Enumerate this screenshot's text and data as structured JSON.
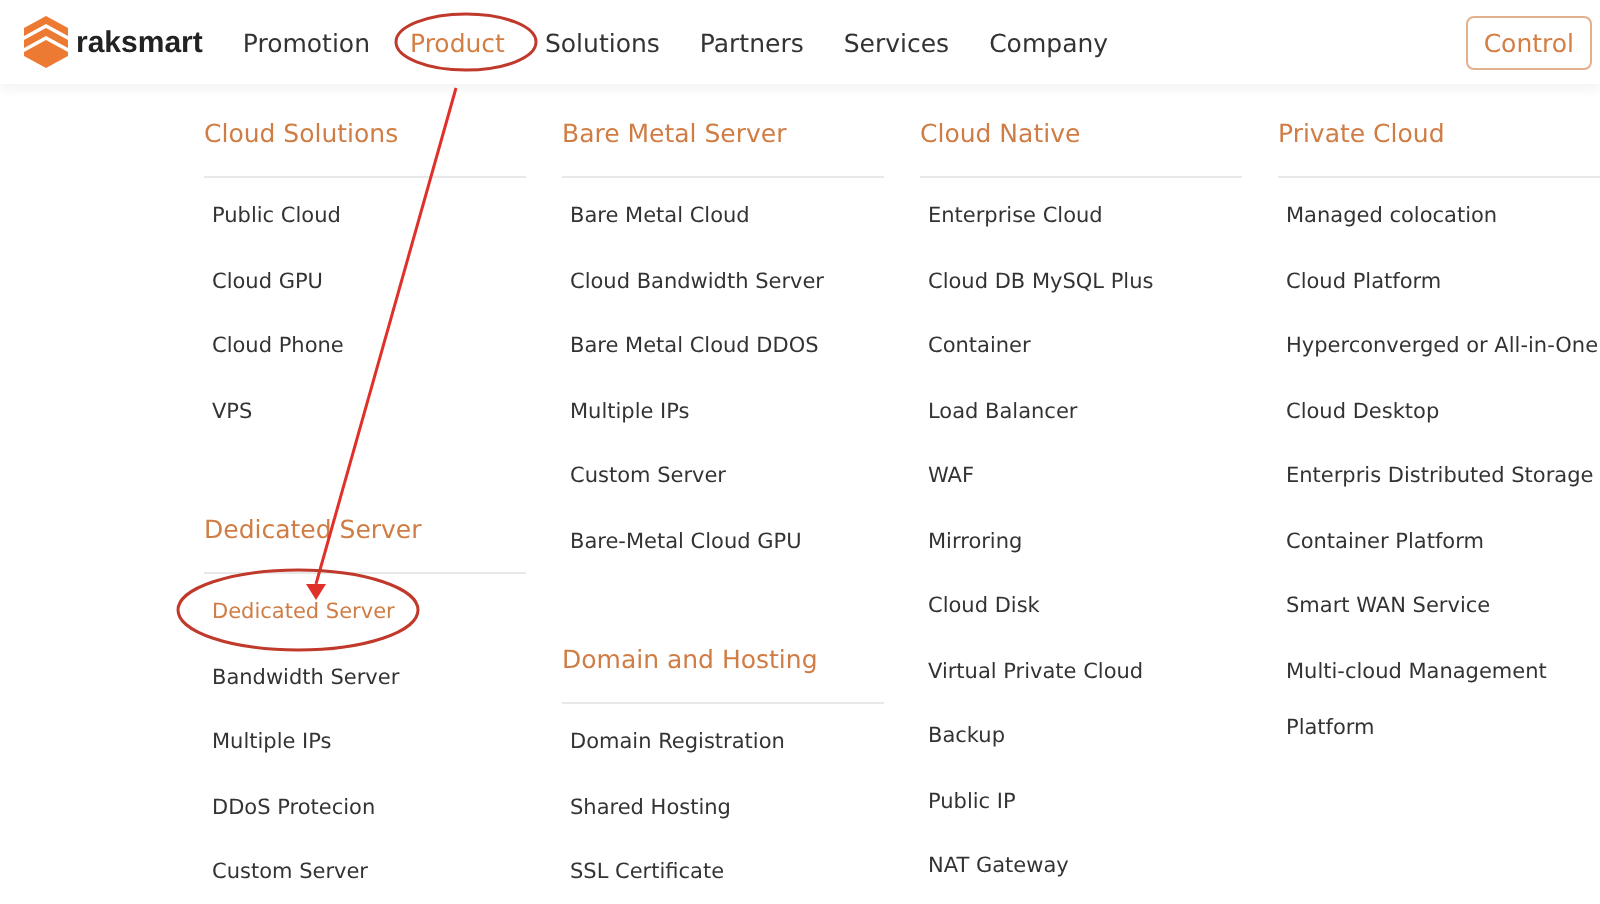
{
  "brand": {
    "name": "raksmart"
  },
  "nav": [
    {
      "label": "Promotion",
      "selected": false
    },
    {
      "label": "Product",
      "selected": true
    },
    {
      "label": "Solutions",
      "selected": false
    },
    {
      "label": "Partners",
      "selected": false
    },
    {
      "label": "Services",
      "selected": false
    },
    {
      "label": "Company",
      "selected": false
    }
  ],
  "control_button": "Control",
  "menu_columns": [
    {
      "groups": [
        {
          "title": "Cloud Solutions",
          "items": [
            {
              "label": "Public Cloud",
              "selected": false
            },
            {
              "label": "Cloud GPU",
              "selected": false
            },
            {
              "label": "Cloud Phone",
              "selected": false
            },
            {
              "label": "VPS",
              "selected": false
            }
          ]
        },
        {
          "title": "Dedicated Server",
          "items": [
            {
              "label": "Dedicated Server",
              "selected": true
            },
            {
              "label": "Bandwidth Server",
              "selected": false
            },
            {
              "label": "Multiple IPs",
              "selected": false
            },
            {
              "label": "DDoS Protecion",
              "selected": false
            },
            {
              "label": "Custom Server",
              "selected": false
            }
          ]
        }
      ]
    },
    {
      "groups": [
        {
          "title": "Bare Metal Server",
          "items": [
            {
              "label": "Bare Metal Cloud",
              "selected": false
            },
            {
              "label": "Cloud Bandwidth Server",
              "selected": false
            },
            {
              "label": "Bare Metal Cloud DDOS",
              "selected": false
            },
            {
              "label": "Multiple IPs",
              "selected": false
            },
            {
              "label": "Custom Server",
              "selected": false
            },
            {
              "label": "Bare-Metal Cloud GPU",
              "selected": false
            }
          ]
        },
        {
          "title": "Domain and Hosting",
          "items": [
            {
              "label": "Domain Registration",
              "selected": false
            },
            {
              "label": "Shared Hosting",
              "selected": false
            },
            {
              "label": "SSL Certificate",
              "selected": false
            }
          ]
        }
      ]
    },
    {
      "groups": [
        {
          "title": "Cloud Native",
          "items": [
            {
              "label": "Enterprise Cloud",
              "selected": false
            },
            {
              "label": "Cloud DB MySQL Plus",
              "selected": false
            },
            {
              "label": "Container",
              "selected": false
            },
            {
              "label": "Load Balancer",
              "selected": false
            },
            {
              "label": "WAF",
              "selected": false
            },
            {
              "label": "Mirroring",
              "selected": false
            },
            {
              "label": "Cloud Disk",
              "selected": false
            },
            {
              "label": "Virtual Private Cloud",
              "selected": false
            },
            {
              "label": "Backup",
              "selected": false
            },
            {
              "label": "Public IP",
              "selected": false
            },
            {
              "label": "NAT Gateway",
              "selected": false
            }
          ]
        }
      ]
    },
    {
      "groups": [
        {
          "title": "Private Cloud",
          "items": [
            {
              "label": "Managed colocation",
              "selected": false
            },
            {
              "label": "Cloud Platform",
              "selected": false
            },
            {
              "label": "Hyperconverged or All-in-One",
              "selected": false
            },
            {
              "label": "Cloud Desktop",
              "selected": false
            },
            {
              "label": "Enterpris Distributed Storage",
              "selected": false
            },
            {
              "label": "Container Platform",
              "selected": false
            },
            {
              "label": "Smart WAN Service",
              "selected": false
            },
            {
              "label": "Multi-cloud Management Platform",
              "selected": false
            }
          ]
        }
      ]
    }
  ]
}
